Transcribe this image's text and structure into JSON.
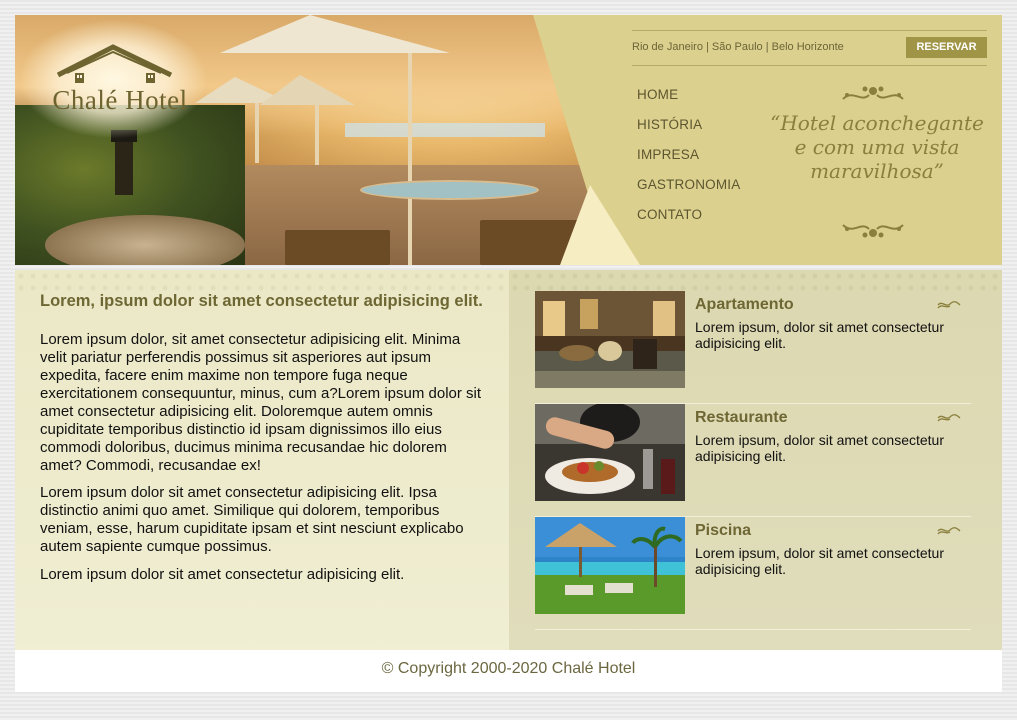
{
  "brand": {
    "logo_text": "Chalé Hotel"
  },
  "header": {
    "cities": "Rio de Janeiro | São Paulo | Belo Horizonte",
    "reserve_label": "RESERVAR",
    "nav": [
      "HOME",
      "HISTÓRIA",
      "IMPRESA",
      "GASTRONOMIA",
      "CONTATO"
    ],
    "tagline_1": "“Hotel aconchegante",
    "tagline_2": "e com uma vista",
    "tagline_3": "maravilhosa”"
  },
  "main": {
    "heading": "Lorem, ipsum dolor sit amet consectetur adipisicing elit.",
    "paragraphs": [
      "Lorem ipsum dolor, sit amet consectetur adipisicing elit. Minima velit pariatur perferendis possimus sit asperiores aut ipsum expedita, facere enim maxime non tempore fuga neque exercitationem consequuntur, minus, cum a?Lorem ipsum dolor sit amet consectetur adipisicing elit. Doloremque autem omnis cupiditate temporibus distinctio id ipsam dignissimos illo eius commodi doloribus, ducimus minima recusandae hic dolorem amet? Commodi, recusandae ex!",
      "Lorem ipsum dolor sit amet consectetur adipisicing elit. Ipsa distinctio animi quo amet. Similique qui dolorem, temporibus veniam, esse, harum cupiditate ipsam et sint nesciunt explicabo autem sapiente cumque possimus.",
      "Lorem ipsum dolor sit amet consectetur adipisicing elit."
    ]
  },
  "cards": [
    {
      "title": "Apartamento",
      "text": "Lorem ipsum, dolor sit amet consectetur adipisicing elit."
    },
    {
      "title": "Restaurante",
      "text": "Lorem ipsum, dolor sit amet consectetur adipisicing elit."
    },
    {
      "title": "Piscina",
      "text": "Lorem ipsum, dolor sit amet consectetur adipisicing elit."
    }
  ],
  "footer": {
    "copyright": "© Copyright 2000-2020 Chalé Hotel"
  },
  "colors": {
    "header_bg": "#dcd08e",
    "accent_olive": "#6e6734",
    "reserve_bg": "#a09546",
    "left_panel": "#ebe8c6",
    "right_panel": "#dcd8b0"
  }
}
